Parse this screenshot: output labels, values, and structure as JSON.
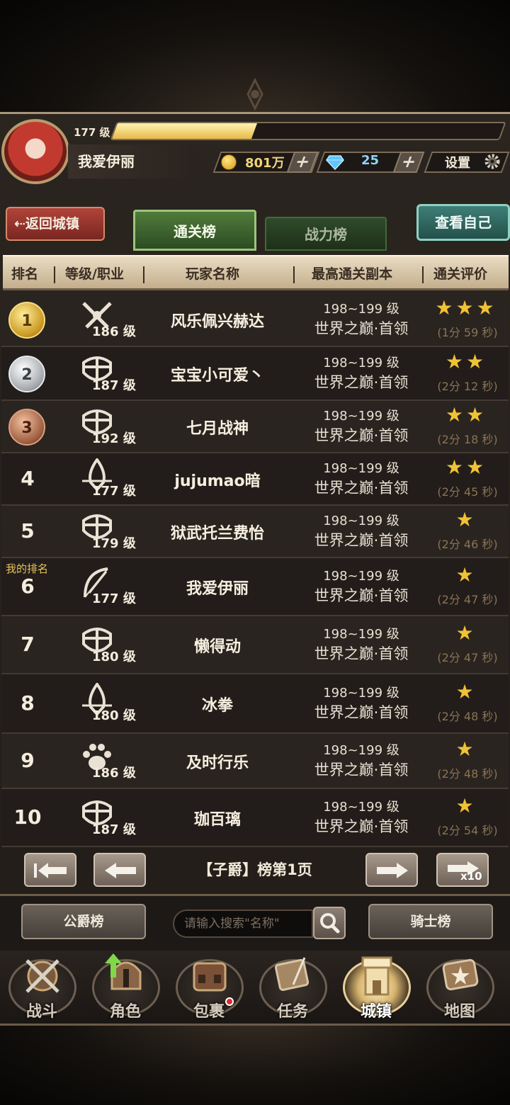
{
  "header": {
    "level_label": "177 级",
    "xp_fraction": 0.36,
    "player_name": "我爱伊丽",
    "gold": "801万",
    "gems": "25",
    "plus": "+",
    "settings_label": "设置"
  },
  "tabs": {
    "back_label": "返回城镇",
    "active": "通关榜",
    "inactive": "战力榜",
    "self_label": "查看自己"
  },
  "table": {
    "headers": [
      "排名",
      "等级/职业",
      "玩家名称",
      "最高通关副本",
      "通关评价"
    ],
    "my_rank_label": "我的排名",
    "rows": [
      {
        "rank": "1",
        "icon": "swords-icon",
        "level": "186 级",
        "name": "风乐佩兴赫达",
        "dungeon_level": "198~199 级",
        "dungeon": "世界之巅·首领",
        "stars": "★★★",
        "time": "(1分 59 秒)"
      },
      {
        "rank": "2",
        "icon": "shield-cross-icon",
        "level": "187 级",
        "name": "宝宝小可爱丶",
        "dungeon_level": "198~199 级",
        "dungeon": "世界之巅·首领",
        "stars": "★★",
        "time": "(2分 12 秒)"
      },
      {
        "rank": "3",
        "icon": "shield-cross-icon",
        "level": "192 级",
        "name": "七月战神",
        "dungeon_level": "198~199 级",
        "dungeon": "世界之巅·首领",
        "stars": "★★",
        "time": "(2分 18 秒)"
      },
      {
        "rank": "4",
        "icon": "mage-flame-icon",
        "level": "177 级",
        "name": "jujumao暗",
        "dungeon_level": "198~199 级",
        "dungeon": "世界之巅·首领",
        "stars": "★★",
        "time": "(2分 45 秒)"
      },
      {
        "rank": "5",
        "icon": "shield-cross-icon",
        "level": "179 级",
        "name": "狱武托兰费怡",
        "dungeon_level": "198~199 级",
        "dungeon": "世界之巅·首领",
        "stars": "★",
        "time": "(2分 46 秒)"
      },
      {
        "rank": "6",
        "icon": "bow-icon",
        "level": "177 级",
        "name": "我爱伊丽",
        "dungeon_level": "198~199 级",
        "dungeon": "世界之巅·首领",
        "stars": "★",
        "time": "(2分 47 秒)"
      },
      {
        "rank": "7",
        "icon": "shield-cross-icon",
        "level": "180 级",
        "name": "懒得动",
        "dungeon_level": "198~199 级",
        "dungeon": "世界之巅·首领",
        "stars": "★",
        "time": "(2分 47 秒)"
      },
      {
        "rank": "8",
        "icon": "mage-flame-icon",
        "level": "180 级",
        "name": "冰拳",
        "dungeon_level": "198~199 级",
        "dungeon": "世界之巅·首领",
        "stars": "★",
        "time": "(2分 48 秒)"
      },
      {
        "rank": "9",
        "icon": "paw-icon",
        "level": "186 级",
        "name": "及时行乐",
        "dungeon_level": "198~199 级",
        "dungeon": "世界之巅·首领",
        "stars": "★",
        "time": "(2分 48 秒)"
      },
      {
        "rank": "10",
        "icon": "shield-cross-icon",
        "level": "187 级",
        "name": "珈百璃",
        "dungeon_level": "198~199 级",
        "dungeon": "世界之巅·首领",
        "stars": "★",
        "time": "(2分 54 秒)"
      }
    ]
  },
  "pagination": {
    "label": "【子爵】榜第1页",
    "x10": "x10"
  },
  "bottom": {
    "left_button": "公爵榜",
    "search_placeholder": "请输入搜索\"名称\"",
    "right_button": "骑士榜"
  },
  "nav": [
    {
      "label": "战斗",
      "icon": "battle-shield-icon"
    },
    {
      "label": "角色",
      "icon": "helmet-icon"
    },
    {
      "label": "包裹",
      "icon": "backpack-icon"
    },
    {
      "label": "任务",
      "icon": "scroll-icon"
    },
    {
      "label": "城镇",
      "icon": "castle-tower-icon"
    },
    {
      "label": "地图",
      "icon": "map-icon"
    }
  ],
  "colors": {
    "accent_gold": "#f0c235",
    "tab_green": "#4f7b3c",
    "back_red": "#b0443a",
    "self_teal": "#3e7f78"
  }
}
